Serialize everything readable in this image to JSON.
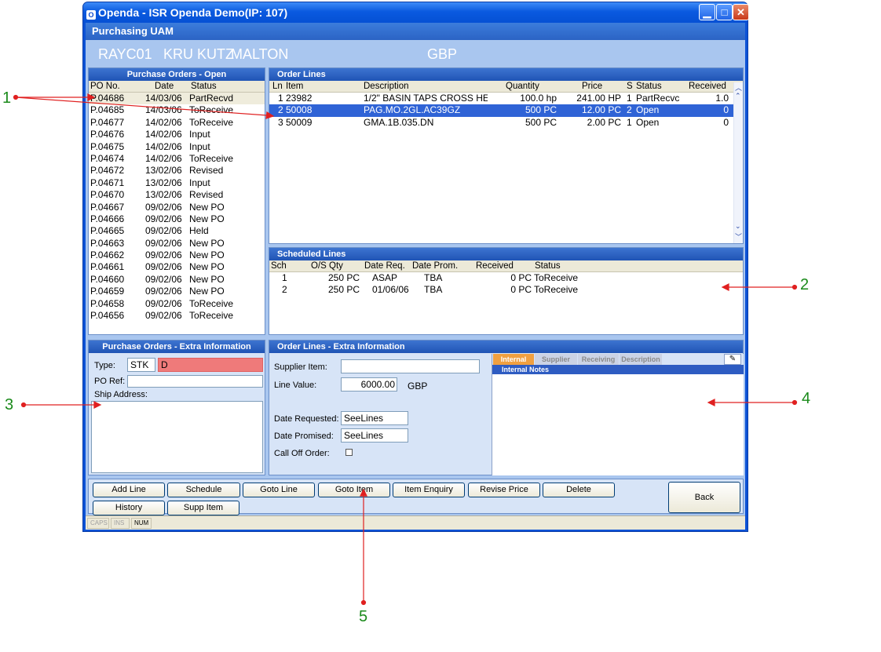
{
  "window": {
    "app": "Openda",
    "title": "Openda  -  ISR Openda Demo(IP: 107)",
    "subtitle": "Purchasing UAM"
  },
  "customer": {
    "code": "RAYC01",
    "name1": "KRU KUTZ",
    "name2": "MALTON",
    "currency": "GBP"
  },
  "po_panel": {
    "title": "Purchase Orders - Open",
    "columns": [
      "PO No.",
      "Date",
      "Status"
    ],
    "rows": [
      [
        "P.04686",
        "14/03/06",
        "PartRecvd"
      ],
      [
        "P.04685",
        "14/03/06",
        "ToReceive"
      ],
      [
        "P.04677",
        "14/02/06",
        "ToReceive"
      ],
      [
        "P.04676",
        "14/02/06",
        "Input"
      ],
      [
        "P.04675",
        "14/02/06",
        "Input"
      ],
      [
        "P.04674",
        "14/02/06",
        "ToReceive"
      ],
      [
        "P.04672",
        "13/02/06",
        "Revised"
      ],
      [
        "P.04671",
        "13/02/06",
        "Input"
      ],
      [
        "P.04670",
        "13/02/06",
        "Revised"
      ],
      [
        "P.04667",
        "09/02/06",
        "New PO"
      ],
      [
        "P.04666",
        "09/02/06",
        "New PO"
      ],
      [
        "P.04665",
        "09/02/06",
        "Held"
      ],
      [
        "P.04663",
        "09/02/06",
        "New PO"
      ],
      [
        "P.04662",
        "09/02/06",
        "New PO"
      ],
      [
        "P.04661",
        "09/02/06",
        "New PO"
      ],
      [
        "P.04660",
        "09/02/06",
        "New PO"
      ],
      [
        "P.04659",
        "09/02/06",
        "New PO"
      ],
      [
        "P.04658",
        "09/02/06",
        "ToReceive"
      ],
      [
        "P.04656",
        "09/02/06",
        "ToReceive"
      ]
    ]
  },
  "order_lines": {
    "title": "Order Lines",
    "columns": [
      "Ln",
      "Item",
      "Description",
      "Quantity",
      "Price",
      "S",
      "Status",
      "Received"
    ],
    "rows": [
      [
        "1",
        "23982",
        "1/2\" BASIN TAPS CROSS HE.",
        "100.0 hp",
        "241.00 HP",
        "1",
        "PartRecvc",
        "1.0"
      ],
      [
        "2",
        "50008",
        "PAG.MO.2GL.AC39GZ",
        "500 PC",
        "12.00 PC",
        "2",
        "Open",
        "0"
      ],
      [
        "3",
        "50009",
        "GMA.1B.035.DN",
        "500 PC",
        "2.00 PC",
        "1",
        "Open",
        "0"
      ]
    ]
  },
  "scheduled_lines": {
    "title": "Scheduled Lines",
    "columns": [
      "Sch",
      "O/S Qty",
      "Date Req.",
      "Date Prom.",
      "Received",
      "Status"
    ],
    "rows": [
      [
        "1",
        "250 PC",
        "ASAP",
        "TBA",
        "0 PC",
        "ToReceive"
      ],
      [
        "2",
        "250 PC",
        "01/06/06",
        "TBA",
        "0 PC",
        "ToReceive"
      ]
    ]
  },
  "po_extra": {
    "title": "Purchase Orders - Extra Information",
    "type_label": "Type:",
    "type_value": "STK",
    "type_desc": "D",
    "poref_label": "PO Ref:",
    "poref_value": "",
    "ship_label": "Ship Address:",
    "ship_value": ""
  },
  "ol_extra": {
    "title": "Order Lines - Extra Information",
    "supplier_item_label": "Supplier Item:",
    "supplier_item_value": "",
    "line_value_label": "Line Value:",
    "line_value": "6000.00",
    "line_value_cur": "GBP",
    "date_req_label": "Date Requested:",
    "date_req_value": "SeeLines",
    "date_prom_label": "Date Promised:",
    "date_prom_value": "SeeLines",
    "calloff_label": "Call Off Order:",
    "tabs": [
      "Internal",
      "Supplier",
      "Receiving",
      "Description"
    ],
    "notes_title": "Internal Notes"
  },
  "buttons": {
    "add_line": "Add Line",
    "schedule": "Schedule",
    "goto_line": "Goto Line",
    "goto_item": "Goto Item",
    "item_enquiry": "Item Enquiry",
    "revise_price": "Revise Price",
    "delete": "Delete",
    "history": "History",
    "supp_item": "Supp Item",
    "back": "Back"
  },
  "statusbar": [
    "CAPS",
    "INS",
    "NUM"
  ],
  "annotations": [
    "1",
    "2",
    "3",
    "4",
    "5"
  ]
}
